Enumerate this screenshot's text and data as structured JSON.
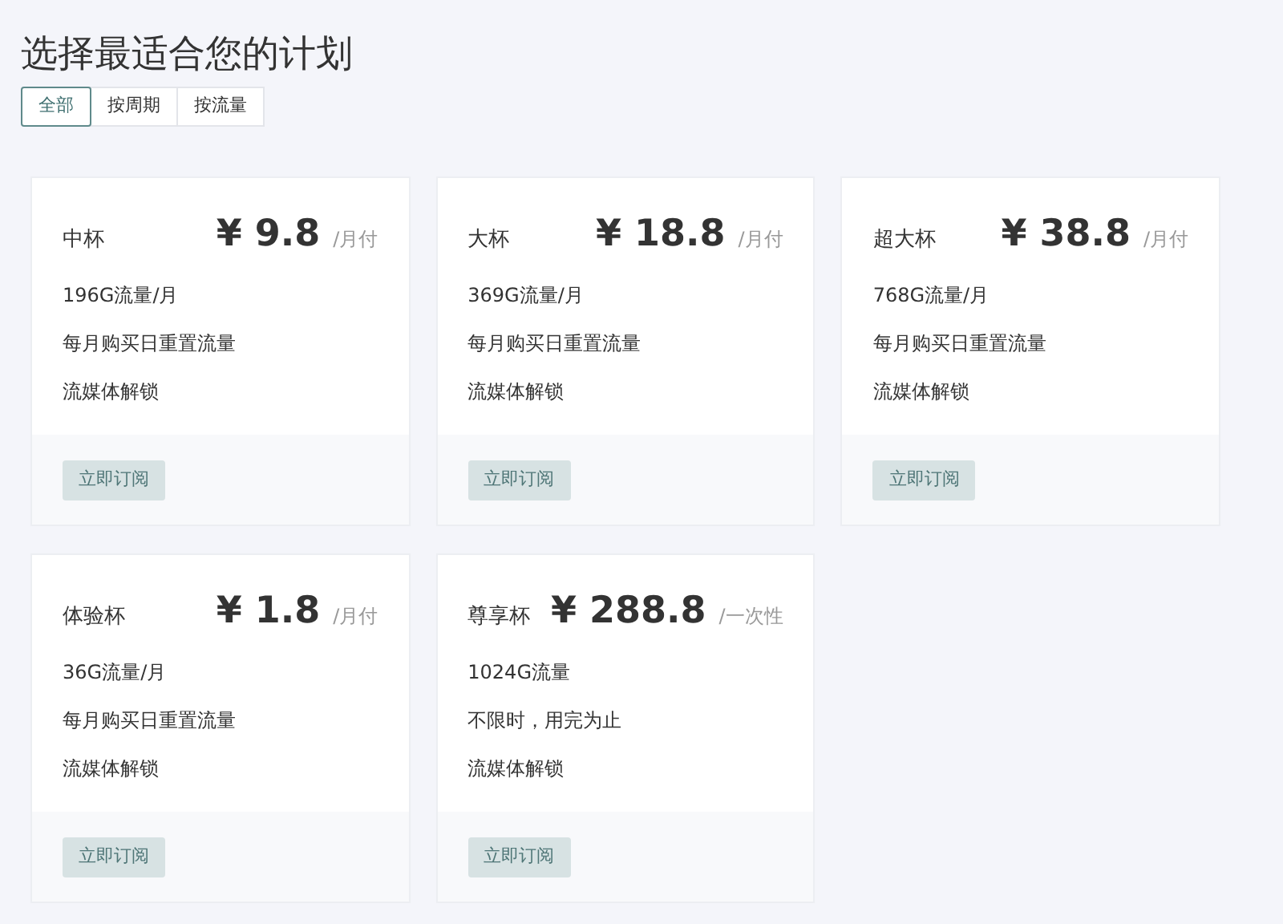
{
  "title": "选择最适合您的计划",
  "tabs": [
    {
      "label": "全部",
      "selected": true
    },
    {
      "label": "按周期",
      "selected": false
    },
    {
      "label": "按流量",
      "selected": false
    }
  ],
  "plans": [
    {
      "name": "中杯",
      "price": "¥ 9.8",
      "period": "/月付",
      "features": [
        "196G流量/月",
        "每月购买日重置流量",
        "流媒体解锁"
      ],
      "button": "立即订阅"
    },
    {
      "name": "大杯",
      "price": "¥ 18.8",
      "period": "/月付",
      "features": [
        "369G流量/月",
        "每月购买日重置流量",
        "流媒体解锁"
      ],
      "button": "立即订阅"
    },
    {
      "name": "超大杯",
      "price": "¥ 38.8",
      "period": "/月付",
      "features": [
        "768G流量/月",
        "每月购买日重置流量",
        "流媒体解锁"
      ],
      "button": "立即订阅"
    },
    {
      "name": "体验杯",
      "price": "¥ 1.8",
      "period": "/月付",
      "features": [
        "36G流量/月",
        "每月购买日重置流量",
        "流媒体解锁"
      ],
      "button": "立即订阅"
    },
    {
      "name": "尊享杯",
      "price": "¥ 288.8",
      "period": "/一次性",
      "features": [
        "1024G流量",
        "不限时，用完为止",
        "流媒体解锁"
      ],
      "button": "立即订阅"
    }
  ]
}
